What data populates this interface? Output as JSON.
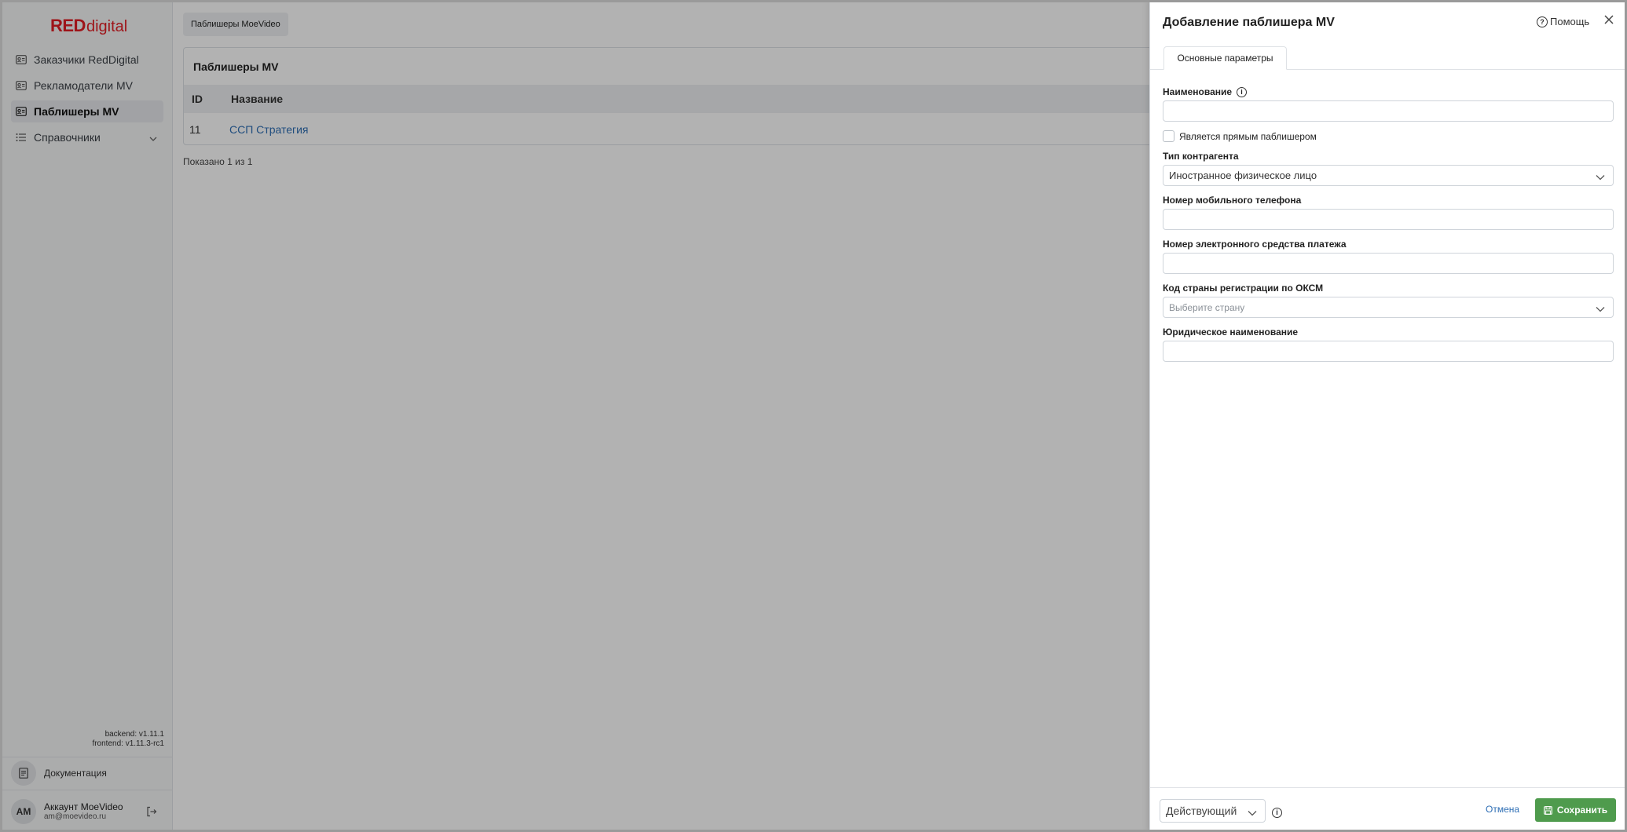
{
  "logo": {
    "red": "RED",
    "digital": "digital"
  },
  "sidebar": {
    "items": [
      {
        "label": "Заказчики RedDigital",
        "icon": "id-card-icon"
      },
      {
        "label": "Рекламодатели MV",
        "icon": "id-card-icon"
      },
      {
        "label": "Паблишеры MV",
        "icon": "id-card-icon",
        "active": true
      },
      {
        "label": "Справочники",
        "icon": "list-icon"
      }
    ],
    "backend_version": "backend: v1.11.1",
    "frontend_version": "frontend: v1.11.3-rc1",
    "docs_label": "Документация",
    "account": {
      "initials": "AM",
      "name": "Аккаунт MoeVideo",
      "email": "am@moevideo.ru"
    }
  },
  "main": {
    "breadcrumb": "Паблишеры MoeVideo",
    "card_title": "Паблишеры MV",
    "columns": [
      "ID",
      "Название"
    ],
    "rows": [
      {
        "id": "11",
        "name": "ССП Стратегия"
      }
    ],
    "shown": "Показано 1 из 1"
  },
  "drawer": {
    "title": "Добавление паблишера MV",
    "help": "Помощь",
    "tab": "Основные параметры",
    "fields": {
      "name_label": "Наименование",
      "direct_label": "Является прямым паблишером",
      "type_label": "Тип контрагента",
      "type_value": "Иностранное физическое лицо",
      "phone_label": "Номер мобильного телефона",
      "payment_label": "Номер электронного средства платежа",
      "country_label": "Код страны регистрации по ОКСМ",
      "country_placeholder": "Выберите страну",
      "legal_label": "Юридическое наименование"
    },
    "footer": {
      "status": "Действующий",
      "cancel": "Отмена",
      "save": "Сохранить"
    }
  },
  "colors": {
    "brand": "#e31e24",
    "accent": "#2f6fb5",
    "save": "#4f9b4d"
  }
}
